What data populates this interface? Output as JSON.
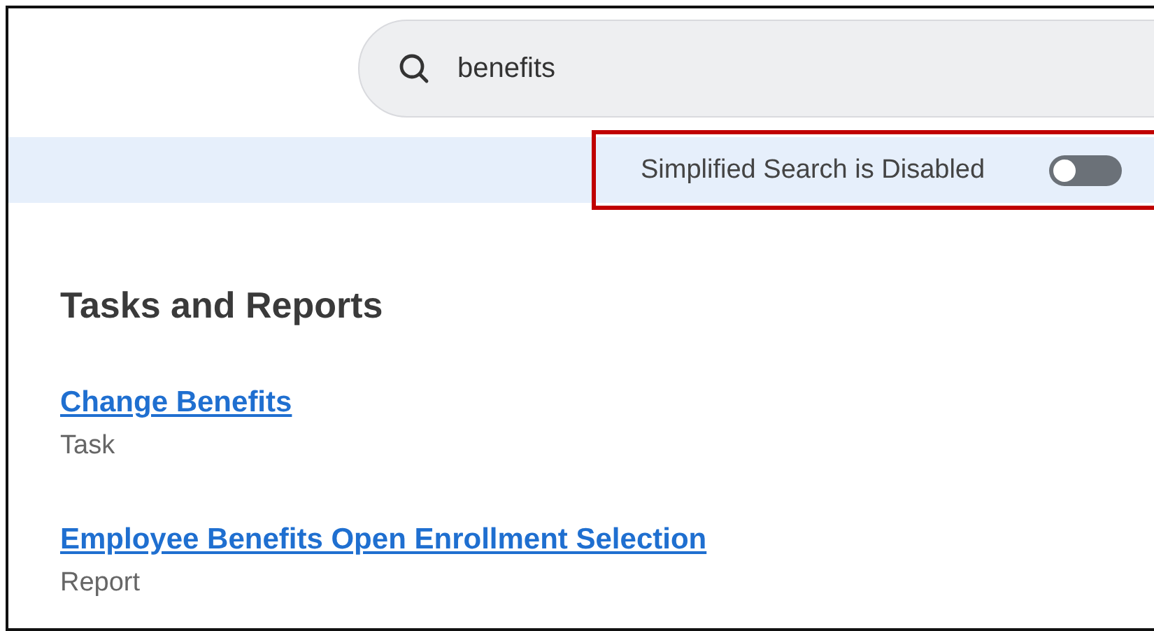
{
  "search": {
    "value": "benefits"
  },
  "simplified_search": {
    "label": "Simplified Search is Disabled",
    "on": false,
    "highlighted": true
  },
  "section": {
    "title": "Tasks and Reports"
  },
  "results": [
    {
      "title": "Change Benefits",
      "type": "Task"
    },
    {
      "title": "Employee Benefits Open Enrollment Selection",
      "type": "Report"
    }
  ]
}
